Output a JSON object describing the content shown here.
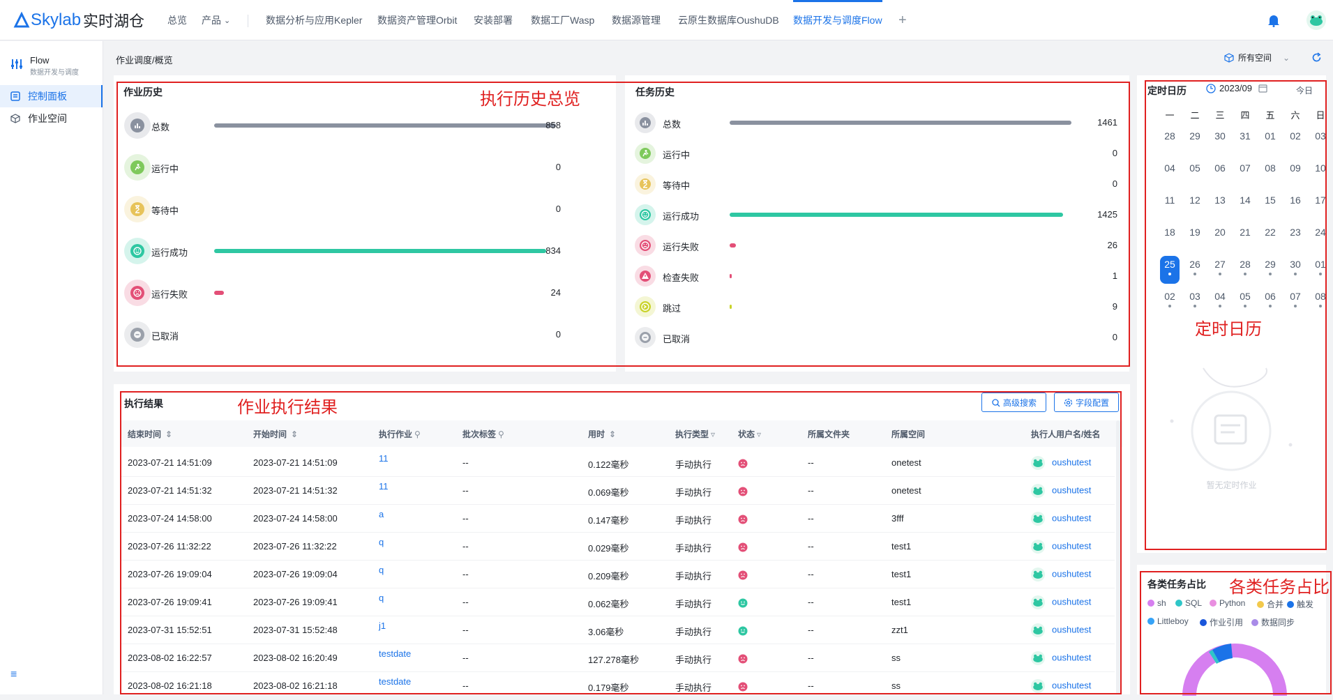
{
  "topbar": {
    "logo": "Skylab",
    "logo_cn": "实时湖仓",
    "nav": [
      "总览",
      "产品",
      "数据分析与应用Kepler",
      "数据资产管理Orbit",
      "安装部署",
      "数据工厂Wasp",
      "数据源管理",
      "云原生数据库OushuDB",
      "数据开发与调度Flow"
    ],
    "active_nav": "数据开发与调度Flow",
    "add_icon": "plus-icon",
    "bell_icon": "bell-icon"
  },
  "sidebar": {
    "app_name": "Flow",
    "app_sub": "数据开发与调度",
    "items": [
      {
        "label": "控制面板",
        "icon": "dashboard-icon",
        "active": true
      },
      {
        "label": "作业空间",
        "icon": "cube-icon",
        "active": false
      }
    ]
  },
  "header": {
    "breadcrumb": "作业调度/概览",
    "space_select": "所有空间"
  },
  "job_history": {
    "title": "作业历史",
    "rows": [
      {
        "label": "总数",
        "value": "858",
        "ratio": 1.0,
        "color": "#8a919f",
        "icon": "chart-icon"
      },
      {
        "label": "运行中",
        "value": "0",
        "ratio": 0,
        "color": "#7ec95b",
        "icon": "run-icon"
      },
      {
        "label": "等待中",
        "value": "0",
        "ratio": 0,
        "color": "#e7c35a",
        "icon": "hourglass-icon"
      },
      {
        "label": "运行成功",
        "value": "834",
        "ratio": 0.972,
        "color": "#2ec7a2",
        "icon": "smile-icon"
      },
      {
        "label": "运行失败",
        "value": "24",
        "ratio": 0.028,
        "color": "#e34f77",
        "icon": "sad-icon"
      },
      {
        "label": "已取消",
        "value": "0",
        "ratio": 0,
        "color": "#9aa0aa",
        "icon": "minus-icon"
      }
    ]
  },
  "task_history": {
    "title": "任务历史",
    "rows": [
      {
        "label": "总数",
        "value": "1461",
        "ratio": 1.0,
        "color": "#8a919f",
        "icon": "chart-icon"
      },
      {
        "label": "运行中",
        "value": "0",
        "ratio": 0,
        "color": "#7ec95b",
        "icon": "run-icon"
      },
      {
        "label": "等待中",
        "value": "0",
        "ratio": 0,
        "color": "#e7c35a",
        "icon": "hourglass-icon"
      },
      {
        "label": "运行成功",
        "value": "1425",
        "ratio": 0.975,
        "color": "#2ec7a2",
        "icon": "smile-icon"
      },
      {
        "label": "运行失败",
        "value": "26",
        "ratio": 0.018,
        "color": "#e34f77",
        "icon": "sad-icon"
      },
      {
        "label": "检查失败",
        "value": "1",
        "ratio": 0.002,
        "color": "#e34f77",
        "icon": "warning-icon"
      },
      {
        "label": "跳过",
        "value": "9",
        "ratio": 0.006,
        "color": "#c9d32a",
        "icon": "skip-icon"
      },
      {
        "label": "已取消",
        "value": "0",
        "ratio": 0,
        "color": "#9aa0aa",
        "icon": "minus-icon"
      }
    ]
  },
  "results": {
    "title": "执行结果",
    "advanced_search": "高级搜索",
    "field_config": "字段配置",
    "columns": [
      "结束时间",
      "开始时间",
      "执行作业",
      "批次标签",
      "用时",
      "执行类型",
      "状态",
      "所属文件夹",
      "所属空间",
      "执行人用户名/姓名"
    ],
    "rows": [
      {
        "end": "2023-07-21 14:51:09",
        "start": "2023-07-21 14:51:09",
        "job": "11",
        "tag": "--",
        "dur": "0.122毫秒",
        "type": "手动执行",
        "status": "fail",
        "folder": "--",
        "space": "onetest",
        "user": "oushutest"
      },
      {
        "end": "2023-07-21 14:51:32",
        "start": "2023-07-21 14:51:32",
        "job": "11",
        "tag": "--",
        "dur": "0.069毫秒",
        "type": "手动执行",
        "status": "fail",
        "folder": "--",
        "space": "onetest",
        "user": "oushutest"
      },
      {
        "end": "2023-07-24 14:58:00",
        "start": "2023-07-24 14:58:00",
        "job": "a",
        "tag": "--",
        "dur": "0.147毫秒",
        "type": "手动执行",
        "status": "fail",
        "folder": "--",
        "space": "3fff",
        "user": "oushutest"
      },
      {
        "end": "2023-07-26 11:32:22",
        "start": "2023-07-26 11:32:22",
        "job": "q",
        "tag": "--",
        "dur": "0.029毫秒",
        "type": "手动执行",
        "status": "fail",
        "folder": "--",
        "space": "test1",
        "user": "oushutest"
      },
      {
        "end": "2023-07-26 19:09:04",
        "start": "2023-07-26 19:09:04",
        "job": "q",
        "tag": "--",
        "dur": "0.209毫秒",
        "type": "手动执行",
        "status": "fail",
        "folder": "--",
        "space": "test1",
        "user": "oushutest"
      },
      {
        "end": "2023-07-26 19:09:41",
        "start": "2023-07-26 19:09:41",
        "job": "q",
        "tag": "--",
        "dur": "0.062毫秒",
        "type": "手动执行",
        "status": "success",
        "folder": "--",
        "space": "test1",
        "user": "oushutest"
      },
      {
        "end": "2023-07-31 15:52:51",
        "start": "2023-07-31 15:52:48",
        "job": "j1",
        "tag": "--",
        "dur": "3.06毫秒",
        "type": "手动执行",
        "status": "success",
        "folder": "--",
        "space": "zzt1",
        "user": "oushutest"
      },
      {
        "end": "2023-08-02 16:22:57",
        "start": "2023-08-02 16:20:49",
        "job": "testdate",
        "tag": "--",
        "dur": "127.278毫秒",
        "type": "手动执行",
        "status": "fail",
        "folder": "--",
        "space": "ss",
        "user": "oushutest"
      },
      {
        "end": "2023-08-02 16:21:18",
        "start": "2023-08-02 16:21:18",
        "job": "testdate",
        "tag": "--",
        "dur": "0.179毫秒",
        "type": "手动执行",
        "status": "fail",
        "folder": "--",
        "space": "ss",
        "user": "oushutest"
      }
    ]
  },
  "calendar": {
    "title": "定时日历",
    "month": "2023/09",
    "today_btn": "今日",
    "weekdays": [
      "一",
      "二",
      "三",
      "四",
      "五",
      "六",
      "日"
    ],
    "weeks": [
      [
        [
          "28",
          0
        ],
        [
          "29",
          0
        ],
        [
          "30",
          0
        ],
        [
          "31",
          0
        ],
        [
          "01",
          0
        ],
        [
          "02",
          0
        ],
        [
          "03",
          0
        ]
      ],
      [
        [
          "04",
          0
        ],
        [
          "05",
          0
        ],
        [
          "06",
          0
        ],
        [
          "07",
          0
        ],
        [
          "08",
          0
        ],
        [
          "09",
          0
        ],
        [
          "10",
          0
        ]
      ],
      [
        [
          "11",
          0
        ],
        [
          "12",
          0
        ],
        [
          "13",
          0
        ],
        [
          "14",
          0
        ],
        [
          "15",
          0
        ],
        [
          "16",
          0
        ],
        [
          "17",
          0
        ]
      ],
      [
        [
          "18",
          0
        ],
        [
          "19",
          0
        ],
        [
          "20",
          0
        ],
        [
          "21",
          0
        ],
        [
          "22",
          0
        ],
        [
          "23",
          0
        ],
        [
          "24",
          0
        ]
      ],
      [
        [
          "25",
          1
        ],
        [
          "26",
          1
        ],
        [
          "27",
          1
        ],
        [
          "28",
          1
        ],
        [
          "29",
          1
        ],
        [
          "30",
          1
        ],
        [
          "01",
          1
        ]
      ],
      [
        [
          "02",
          1
        ],
        [
          "03",
          1
        ],
        [
          "04",
          1
        ],
        [
          "05",
          1
        ],
        [
          "06",
          1
        ],
        [
          "07",
          1
        ],
        [
          "08",
          1
        ]
      ]
    ],
    "today": "25",
    "empty_text": "暂无定时作业"
  },
  "task_types": {
    "title": "各类任务占比",
    "legend": [
      {
        "name": "sh",
        "color": "#d67ff0"
      },
      {
        "name": "SQL",
        "color": "#2fc6c8"
      },
      {
        "name": "Python",
        "color": "#e98fe0"
      },
      {
        "name": "合并",
        "color": "#f2c94c"
      },
      {
        "name": "触发",
        "color": "#1b73e8"
      },
      {
        "name": "Littleboy",
        "color": "#36a3f7"
      },
      {
        "name": "作业引用",
        "color": "#1a56db"
      },
      {
        "name": "数据同步",
        "color": "#a98be8"
      }
    ]
  },
  "annotations": {
    "history": "执行历史总览",
    "results": "作业执行结果",
    "calendar": "定时日历",
    "ratio": "各类任务占比"
  }
}
